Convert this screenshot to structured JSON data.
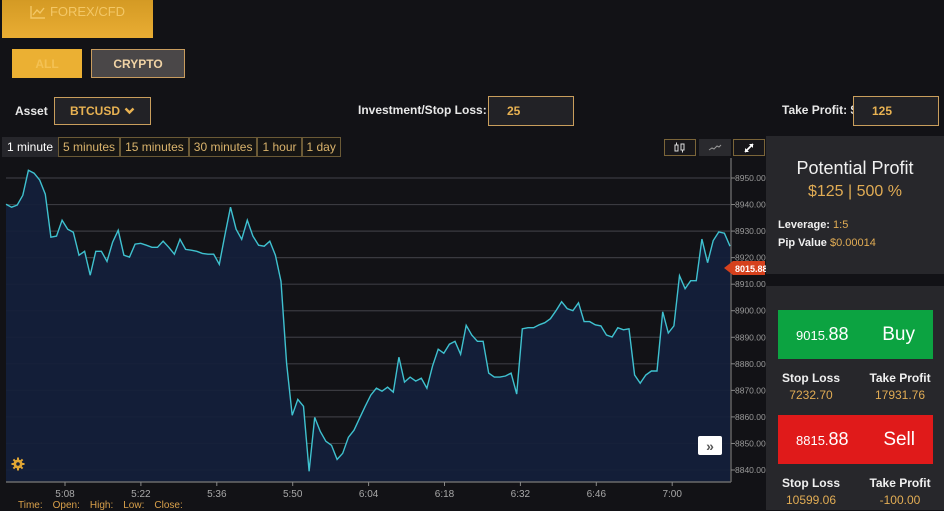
{
  "nav": {
    "forex_tab": {
      "label": "FOREX/CFD",
      "icon": "line-chart-icon"
    },
    "filters": [
      {
        "label": "ALL",
        "active": true
      },
      {
        "label": "CRYPTO",
        "active": false
      }
    ]
  },
  "form": {
    "asset_label": "Asset",
    "asset_value": "BTCUSD",
    "investment_label": "Investment/Stop Loss: $",
    "investment_value": "25",
    "take_profit_label": "Take Profit: $",
    "take_profit_value": "125"
  },
  "timeframes": [
    {
      "label": "1 minute",
      "active": true
    },
    {
      "label": "5 minutes",
      "active": false
    },
    {
      "label": "15 minutes",
      "active": false
    },
    {
      "label": "30 minutes",
      "active": false
    },
    {
      "label": "1 hour",
      "active": false
    },
    {
      "label": "1 day",
      "active": false
    }
  ],
  "chart_tools": [
    "candlestick-icon",
    "line-chart-icon",
    "expand-icon"
  ],
  "ohlc_labels": [
    "Time:",
    "Open:",
    "High:",
    "Low:",
    "Close:"
  ],
  "colors": {
    "accent": "#e1ac54",
    "line": "#3fc1cf",
    "area": "#14203a",
    "buy": "#0ca341",
    "sell": "#e01a1a",
    "current_price_marker": "#d5411d"
  },
  "chart_data": {
    "type": "area",
    "title": "",
    "xlabel": "",
    "ylabel": "",
    "x_ticks": [
      "5:08",
      "5:22",
      "5:36",
      "5:50",
      "6:04",
      "6:18",
      "6:32",
      "6:46",
      "7:00"
    ],
    "y_ticks": [
      "8950.00",
      "8940.00",
      "8930.00",
      "8920.00",
      "8910.00",
      "8900.00",
      "8890.00",
      "8880.00",
      "8870.00",
      "8860.00",
      "8850.00",
      "8840.00"
    ],
    "ylim": [
      8838,
      8955
    ],
    "grid": true,
    "current_price": "8015.88",
    "x_start": "5:01",
    "x_end": "7:12",
    "series": [
      {
        "name": "BTCUSD",
        "values": [
          8940.1,
          8939.0,
          8939.8,
          8943.5,
          8952.9,
          8951.8,
          8949.2,
          8943.9,
          8927.7,
          8928.1,
          8934.1,
          8930.7,
          8929.6,
          8920.9,
          8922.4,
          8913.4,
          8922.4,
          8922.4,
          8918.6,
          8925.8,
          8930.3,
          8920.9,
          8920.2,
          8925.1,
          8925.4,
          8924.7,
          8923.9,
          8923.9,
          8926.2,
          8923.9,
          8921.3,
          8926.9,
          8923.1,
          8922.8,
          8922.4,
          8921.6,
          8921.3,
          8921.3,
          8917.5,
          8928.5,
          8939.0,
          8930.7,
          8926.9,
          8934.1,
          8928.1,
          8924.7,
          8924.3,
          8926.2,
          8920.9,
          8911.1,
          8880.2,
          8860.6,
          8866.6,
          8864.0,
          8839.5,
          8859.8,
          8854.5,
          8850.8,
          8849.3,
          8844.0,
          8846.3,
          8852.3,
          8855.0,
          8859.5,
          8864.0,
          8868.2,
          8870.8,
          8869.7,
          8871.2,
          8869.3,
          8882.5,
          8873.1,
          8875.0,
          8873.5,
          8874.6,
          8870.8,
          8879.1,
          8885.5,
          8884.0,
          8887.4,
          8888.5,
          8883.6,
          8894.5,
          8890.8,
          8888.5,
          8888.5,
          8876.5,
          8875.0,
          8875.0,
          8875.4,
          8876.5,
          8868.6,
          8893.2,
          8893.6,
          8893.6,
          8894.7,
          8895.5,
          8897.0,
          8900.0,
          8903.4,
          8900.8,
          8900.0,
          8903.0,
          8895.9,
          8895.9,
          8894.7,
          8894.3,
          8890.8,
          8890.1,
          8893.6,
          8892.8,
          8893.2,
          8875.8,
          8872.7,
          8875.8,
          8877.3,
          8877.3,
          8899.6,
          8891.6,
          8894.3,
          8913.2,
          8908.3,
          8911.3,
          8911.3,
          8927.0,
          8918.1,
          8926.4,
          8929.7,
          8929.2,
          8924.3
        ]
      }
    ]
  },
  "side": {
    "potential_profit_title": "Potential Profit",
    "potential_profit_value": "$125 | 500 %",
    "leverage_label": "Leverage:",
    "leverage_value": "1:5",
    "pip_label": "Pip Value",
    "pip_value": "$0.00014",
    "buy": {
      "price_small": "9015.",
      "price_big": "88",
      "label": "Buy",
      "stop_loss_label": "Stop Loss",
      "stop_loss": "7232.70",
      "take_profit_label": "Take Profit",
      "take_profit": "17931.76"
    },
    "sell": {
      "price_small": "8815.",
      "price_big": "88",
      "label": "Sell",
      "stop_loss_label": "Stop Loss",
      "stop_loss": "10599.06",
      "take_profit_label": "Take Profit",
      "take_profit": "-100.00"
    }
  }
}
